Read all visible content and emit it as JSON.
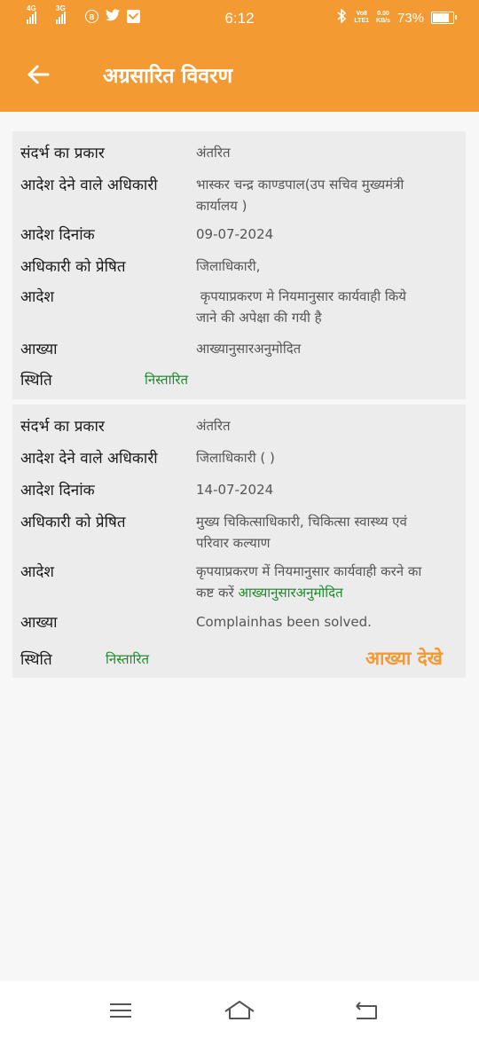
{
  "status_bar": {
    "net1": "4G",
    "net2": "3G",
    "b_label": "B",
    "twitter_icon": "twitter-icon",
    "time": "6:12",
    "volte_top": "Vo8",
    "volte_bottom": "LTE1",
    "speed_top": "0.00",
    "speed_bottom": "KB/s",
    "battery_pct": "73%",
    "battery_level": 0.73
  },
  "app_bar": {
    "title": "अग्रसारित विवरण",
    "back_icon": "back-arrow-icon"
  },
  "records": [
    {
      "type_label": "संदर्भ का प्रकार",
      "type_value": "अंतरित",
      "officer_label": "आदेश देने वाले अधिकारी",
      "officer_line1": "भास्कर चन्द्र  काण्डपाल(उप सचिव मुख्यमंत्री",
      "officer_line2": "कार्यालय )",
      "date_label": "आदेश दिनांक",
      "date_value": "09-07-2024",
      "sent_label": "अधिकारी को प्रेषित",
      "sent_line1": "जिलाधिकारी,",
      "order_label": "आदेश",
      "order_line1": " कृपयाप्रकरण मे नियमानुसार कार्यवाही किये",
      "order_line2": "जाने की अपेक्षा की गयी है",
      "report_label": "आख्या",
      "report_value": "आख्यानुसारअनुमोदित",
      "status_label": "स्थिति",
      "status_value": "निस्तारित"
    },
    {
      "type_label": "संदर्भ का प्रकार",
      "type_value": "अंतरित",
      "officer_label": "आदेश देने वाले अधिकारी",
      "officer_line1": "जिलाधिकारी ( )",
      "date_label": "आदेश दिनांक",
      "date_value": "14-07-2024",
      "sent_label": "अधिकारी को प्रेषित",
      "sent_line1": "मुख्य चिकित्साधिकारी, चिकित्सा स्वास्थ्य एवं",
      "sent_line2": "परिवार कल्याण",
      "order_label": "आदेश",
      "order_line1": "कृपयाप्रकरण में नियमानुसार कार्यवाही करने का",
      "order_line2a": "कष्ट करें ",
      "order_line2b": "आख्यानुसारअनुमोदित",
      "report_label": "आख्या",
      "report_value": "Complainhas been solved.",
      "status_label": "स्थिति",
      "status_value": "निस्तारित",
      "view_report": "आख्या देखे"
    }
  ],
  "nav_bar": {
    "menu_icon": "menu-icon",
    "home_icon": "home-icon",
    "back_icon": "return-icon"
  }
}
